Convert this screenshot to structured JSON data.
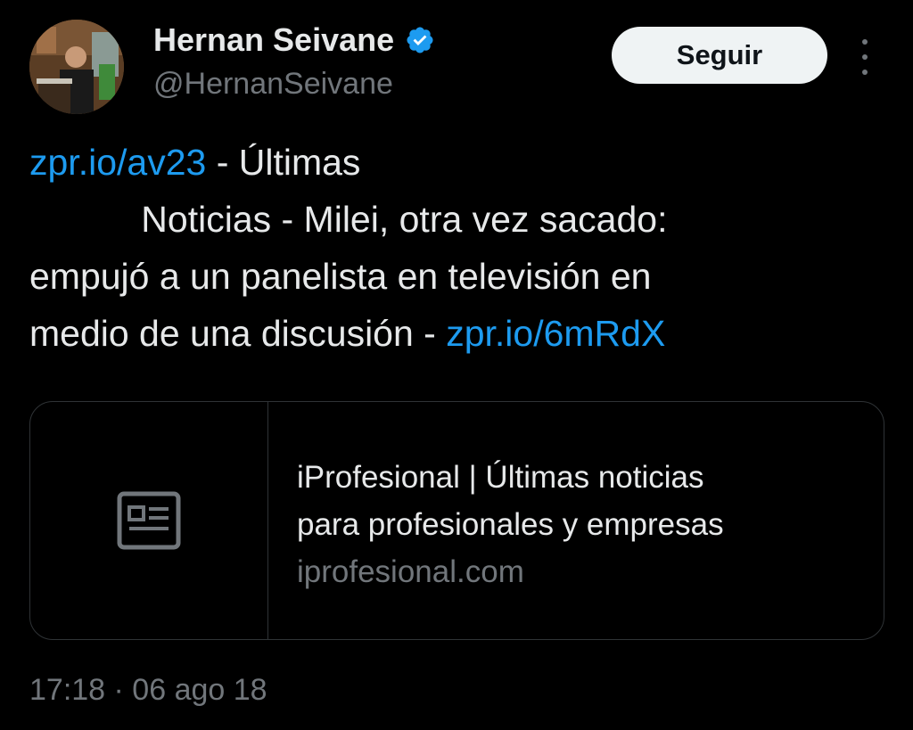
{
  "author": {
    "display_name": "Hernan Seivane",
    "handle": "@HernanSeivane",
    "verified": true,
    "avatar_icon": "profile-photo"
  },
  "actions": {
    "follow_label": "Seguir",
    "more_icon": "more-vertical-icon"
  },
  "tweet": {
    "link1": "zpr.io/av23",
    "line1_rest": " - Últimas",
    "line2": "           Noticias - Milei, otra vez sacado:",
    "line3": "empujó a un panelista en televisión en",
    "line4_text": "medio de una discusión - ",
    "link2": "zpr.io/6mRdX"
  },
  "card": {
    "icon": "newspaper-icon",
    "title_line1": "iProfesional | Últimas noticias",
    "title_line2": "para profesionales y empresas",
    "domain": "iprofesional.com"
  },
  "timestamp": "17:18 · 06 ago 18",
  "colors": {
    "background": "#000000",
    "text": "#e7e9ea",
    "muted": "#71767b",
    "link": "#1d9bf0",
    "verified": "#1d9bf0",
    "border": "#2f3336"
  }
}
